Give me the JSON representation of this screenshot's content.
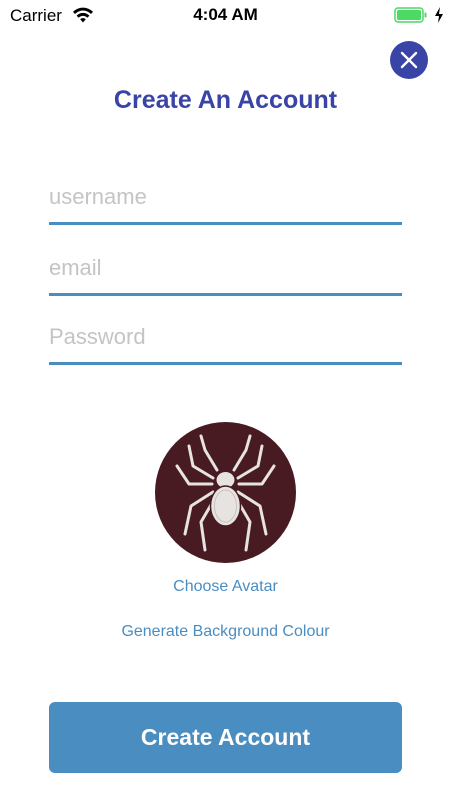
{
  "status_bar": {
    "carrier": "Carrier",
    "time": "4:04 AM"
  },
  "title": "Create An Account",
  "form": {
    "username": {
      "value": "",
      "placeholder": "username"
    },
    "email": {
      "value": "",
      "placeholder": "email"
    },
    "password": {
      "value": "",
      "placeholder": "Password"
    }
  },
  "avatar": {
    "icon": "spider-icon",
    "background_color": "#471b21"
  },
  "links": {
    "choose_avatar": "Choose Avatar",
    "generate_bg": "Generate Background Colour"
  },
  "create_button": "Create Account",
  "colors": {
    "accent": "#4a8dc1",
    "title": "#3a44a6",
    "battery": "#4cd964"
  }
}
